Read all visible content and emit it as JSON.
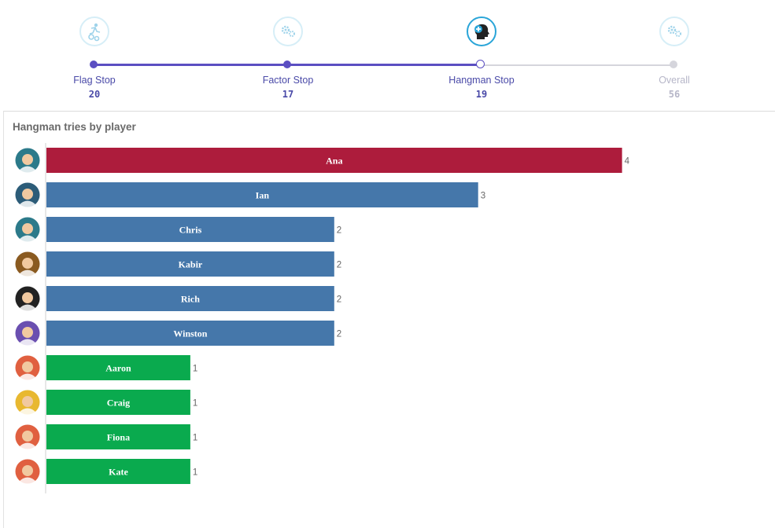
{
  "stepper": {
    "steps": [
      {
        "label": "Flag Stop",
        "value": "20",
        "icon": "runner-gears-icon",
        "state": "done"
      },
      {
        "label": "Factor Stop",
        "value": "17",
        "icon": "gears-icon",
        "state": "done"
      },
      {
        "label": "Hangman Stop",
        "value": "19",
        "icon": "head-plus-icon",
        "state": "current"
      },
      {
        "label": "Overall",
        "value": "56",
        "icon": "gears-icon",
        "state": "future"
      }
    ],
    "colors": {
      "active": "#5b4ec2",
      "inactive": "#d5d5dc",
      "icon_ring": "#2aa5d8"
    }
  },
  "chart_data": {
    "type": "bar",
    "orientation": "horizontal",
    "title": "Hangman tries by player",
    "categories": [
      "Ana",
      "Ian",
      "Chris",
      "Kabir",
      "Rich",
      "Winston",
      "Aaron",
      "Craig",
      "Fiona",
      "Kate"
    ],
    "values": [
      4,
      3,
      2,
      2,
      2,
      2,
      1,
      1,
      1,
      1
    ],
    "bar_colors": [
      "#ad1c3c",
      "#4577aa",
      "#4577aa",
      "#4577aa",
      "#4577aa",
      "#4577aa",
      "#0aaa4e",
      "#0aaa4e",
      "#0aaa4e",
      "#0aaa4e"
    ],
    "avatar_colors": [
      "#2c7a8a",
      "#2c5c78",
      "#2c7a8a",
      "#8a5a20",
      "#222222",
      "#6a4fb0",
      "#e06040",
      "#e8b830",
      "#e06040",
      "#e06040"
    ],
    "xlim": [
      0,
      4.2
    ],
    "grid": false,
    "legend": "none"
  }
}
